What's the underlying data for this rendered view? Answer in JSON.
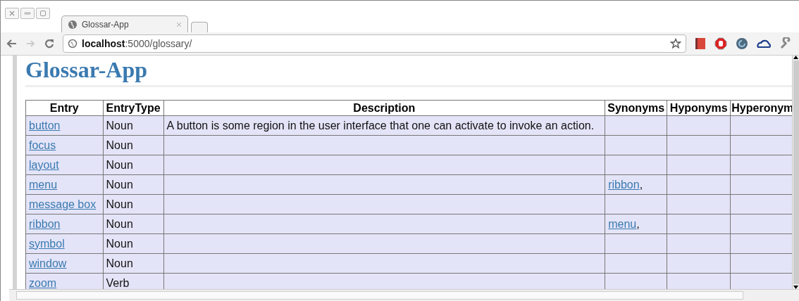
{
  "window": {
    "tab_title": "Glossar-App",
    "address": {
      "host": "localhost",
      "path": ":5000/glossary/"
    }
  },
  "page": {
    "heading": "Glossar-App"
  },
  "table": {
    "columns": [
      "Entry",
      "EntryType",
      "Description",
      "Synonyms",
      "Hyponyms",
      "Hyperonym"
    ],
    "rows": [
      {
        "entry": "button",
        "type": "Noun",
        "description": "A button is some region in the user interface that one can activate to invoke an action.",
        "synonyms": []
      },
      {
        "entry": "focus",
        "type": "Noun",
        "synonyms": []
      },
      {
        "entry": "layout",
        "type": "Noun",
        "synonyms": []
      },
      {
        "entry": "menu",
        "type": "Noun",
        "synonyms": [
          {
            "term": "ribbon",
            "separator": ","
          }
        ]
      },
      {
        "entry": "message box",
        "type": "Noun",
        "synonyms": []
      },
      {
        "entry": "ribbon",
        "type": "Noun",
        "synonyms": [
          {
            "term": "menu",
            "separator": ","
          }
        ]
      },
      {
        "entry": "symbol",
        "type": "Noun",
        "synonyms": []
      },
      {
        "entry": "window",
        "type": "Noun",
        "synonyms": []
      },
      {
        "entry": "zoom",
        "type": "Verb",
        "synonyms": []
      }
    ]
  }
}
